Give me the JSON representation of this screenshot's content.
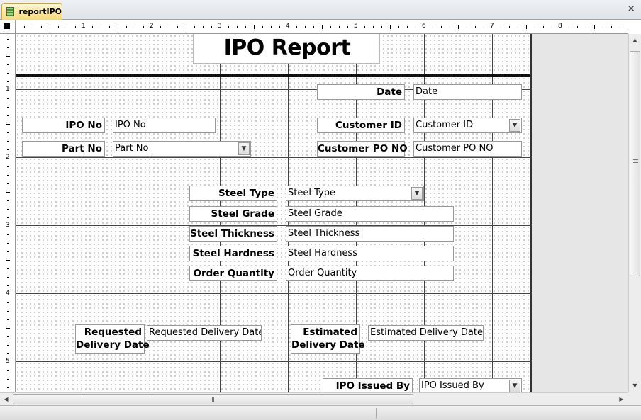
{
  "tab": {
    "label": "reportIPO"
  },
  "ruler": {
    "h_numbers": [
      "1",
      "2",
      "3",
      "4",
      "5",
      "6",
      "7",
      "8"
    ],
    "v_numbers": [
      "1",
      "2",
      "3",
      "4",
      "5"
    ]
  },
  "report": {
    "title": "IPO Report",
    "controls": {
      "date": {
        "label": "Date",
        "field": "Date"
      },
      "ipo_no": {
        "label": "IPO No",
        "field": "IPO No"
      },
      "customer_id": {
        "label": "Customer ID",
        "field": "Customer ID"
      },
      "part_no": {
        "label": "Part No",
        "field": "Part No"
      },
      "customer_po_no": {
        "label": "Customer PO NO",
        "field": "Customer PO NO"
      },
      "steel_type": {
        "label": "Steel Type",
        "field": "Steel Type"
      },
      "steel_grade": {
        "label": "Steel Grade",
        "field": "Steel Grade"
      },
      "steel_thickness": {
        "label": "Steel Thickness",
        "field": "Steel Thickness"
      },
      "steel_hardness": {
        "label": "Steel Hardness",
        "field": "Steel Hardness"
      },
      "order_quantity": {
        "label": "Order Quantity",
        "field": "Order Quantity"
      },
      "requested_delivery": {
        "label_line1": "Requested",
        "label_line2": "Delivery Date",
        "field": "Requested Delivery Date"
      },
      "estimated_delivery": {
        "label_line1": "Estimated",
        "label_line2": "Delivery Date",
        "field": "Estimated Delivery Date"
      },
      "ipo_issued_by": {
        "label": "IPO Issued By",
        "field": "IPO Issued By"
      }
    }
  },
  "icons": {
    "tab": "report-icon",
    "close": "close-icon",
    "combo": "chevron-down-icon"
  }
}
